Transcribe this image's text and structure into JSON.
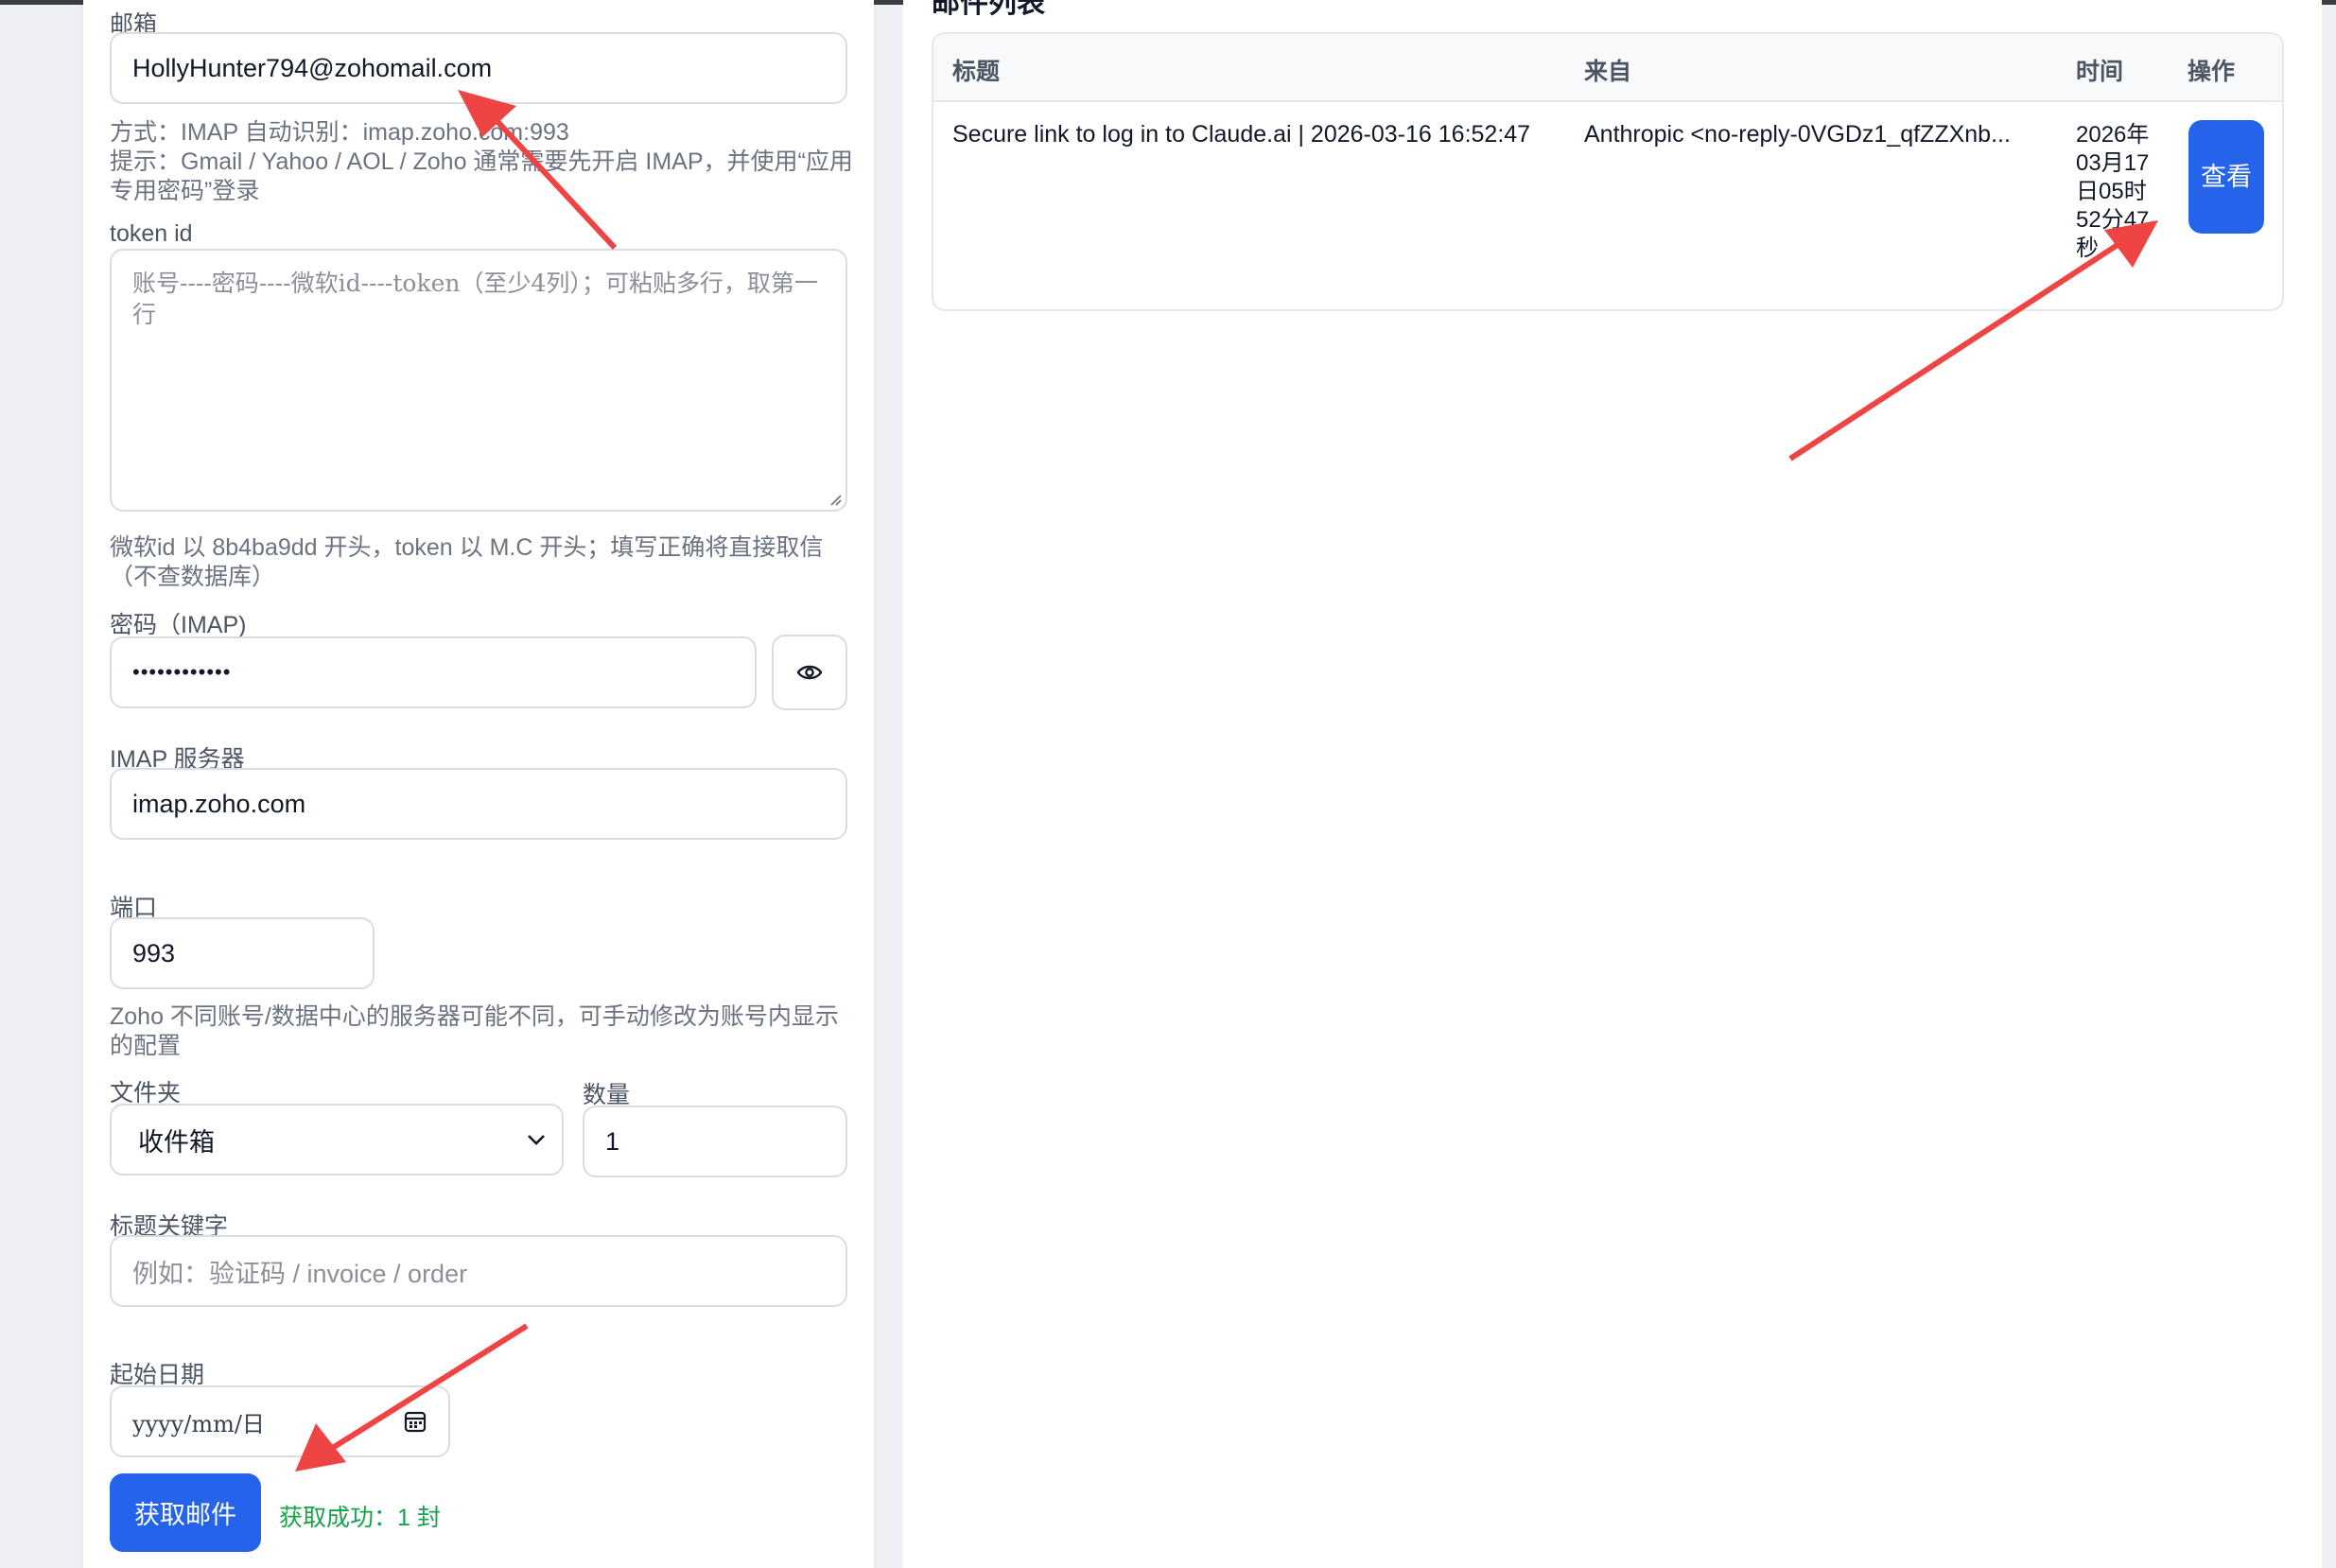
{
  "form": {
    "email_label": "邮箱",
    "email_value": "HollyHunter794@zohomail.com",
    "method_hint": "方式：IMAP   自动识别：imap.zoho.com:993",
    "tip_hint": "提示：Gmail / Yahoo / AOL / Zoho 通常需要先开启 IMAP，并使用“应用专用密码”登录",
    "token_label": "token id",
    "token_placeholder": "账号----密码----微软id----token（至少4列）；可粘贴多行，取第一行",
    "token_hint": "微软id 以 8b4ba9dd 开头，token 以 M.C 开头；填写正确将直接取信（不查数据库）",
    "password_label": "密码（IMAP)",
    "password_value": "••••••••••••",
    "imap_label": "IMAP 服务器",
    "imap_value": "imap.zoho.com",
    "port_label": "端口",
    "port_value": "993",
    "zoho_hint": "Zoho 不同账号/数据中心的服务器可能不同，可手动修改为账号内显示的配置",
    "folder_label": "文件夹",
    "folder_value": "收件箱",
    "count_label": "数量",
    "count_value": "1",
    "keyword_label": "标题关键字",
    "keyword_placeholder": "例如：验证码 / invoice / order",
    "start_date_label": "起始日期",
    "start_date_placeholder": "yyyy/mm/日",
    "fetch_button": "获取邮件",
    "status_text": "获取成功：1 封"
  },
  "mail_list": {
    "title": "邮件列表",
    "columns": [
      "标题",
      "来自",
      "时间",
      "操作"
    ],
    "rows": [
      {
        "subject": "Secure link to log in to Claude.ai | 2026-03-16 16:52:47",
        "from": "Anthropic <no-reply-0VGDz1_qfZZXnb...",
        "time": "2026年03月17日05时52分47秒",
        "action": "查看"
      }
    ]
  },
  "colors": {
    "accent": "#2563eb",
    "success": "#16a34a",
    "annotation_arrow": "#ef4444"
  }
}
